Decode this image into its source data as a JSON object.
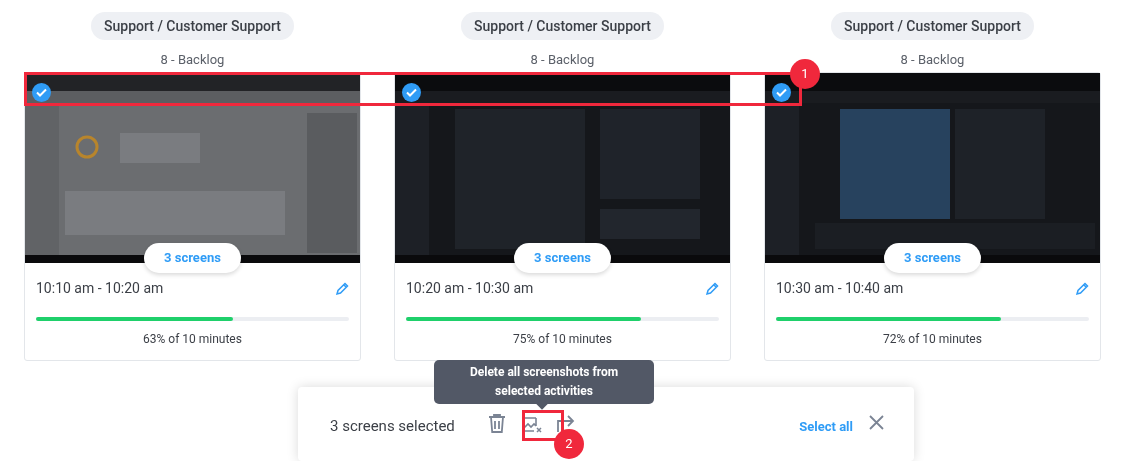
{
  "activities": [
    {
      "project": "Support / Customer Support",
      "task": "8 - Backlog",
      "selected": true,
      "screens": "3 screens",
      "time": "10:10 am - 10:20 am",
      "level": 0.63,
      "summary": "63% of 10 minutes"
    },
    {
      "project": "Support / Customer Support",
      "task": "8 - Backlog",
      "selected": true,
      "screens": "3 screens",
      "time": "10:20 am - 10:30 am",
      "level": 0.75,
      "summary": "75% of 10 minutes"
    },
    {
      "project": "Support / Customer Support",
      "task": "8 - Backlog",
      "selected": true,
      "screens": "3 screens",
      "time": "10:30 am - 10:40 am",
      "level": 0.72,
      "summary": "72% of 10 minutes"
    }
  ],
  "selection_bar": {
    "count": "3 screens selected",
    "tooltip": "Delete all screenshots from selected activities",
    "select_all": "Select all"
  },
  "annotations": [
    {
      "label": "1"
    },
    {
      "label": "2"
    }
  ]
}
